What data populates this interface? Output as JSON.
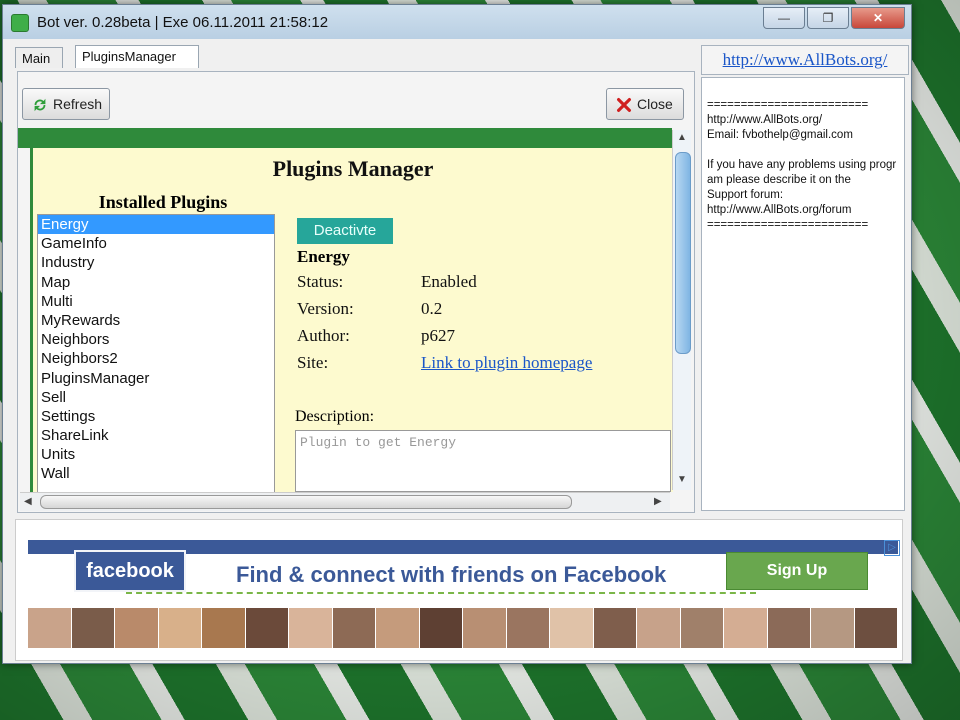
{
  "window": {
    "title": "Bot ver. 0.28beta | Exe 06.11.2011 21:58:12",
    "controls": [
      "—",
      "❐",
      "✕"
    ]
  },
  "tabs": [
    {
      "label": "Main"
    },
    {
      "label": "PluginsManager"
    }
  ],
  "toolbar": {
    "refresh_label": "Refresh",
    "close_label": "Close"
  },
  "plugins_manager": {
    "title": "Plugins Manager",
    "installed_title": "Installed Plugins",
    "plugins": [
      "Energy",
      "GameInfo",
      "Industry",
      "Map",
      "Multi",
      "MyRewards",
      "Neighbors",
      "Neighbors2",
      "PluginsManager",
      "Sell",
      "Settings",
      "ShareLink",
      "Units",
      "Wall"
    ],
    "selected": "Energy",
    "action_label": "Deactivte",
    "detail": {
      "name": "Energy",
      "status_label": "Status:",
      "status": "Enabled",
      "version_label": "Version:",
      "version": "0.2",
      "author_label": "Author:",
      "author": "p627",
      "site_label": "Site:",
      "site": "Link to plugin homepage",
      "description_label": "Description:",
      "description": "Plugin to get Energy"
    }
  },
  "right_panel": {
    "site_link": "http://www.AllBots.org/",
    "log": [
      "========================",
      "http://www.AllBots.org/",
      "Email: fvbothelp@gmail.com",
      "",
      "If you have any problems using program please describe it on the",
      "Support forum:",
      "http://www.AllBots.org/forum",
      "========================"
    ]
  },
  "ad": {
    "brand": "facebook",
    "tagline": "Find & connect with friends on Facebook",
    "button": "Sign Up",
    "brand_color": "#3b5998",
    "button_color": "#69a74e"
  },
  "colors": {
    "panel_green": "#2f8a3b",
    "content_bg": "#fdfacf",
    "selection": "#3399ff",
    "action_button": "#26a69a"
  }
}
